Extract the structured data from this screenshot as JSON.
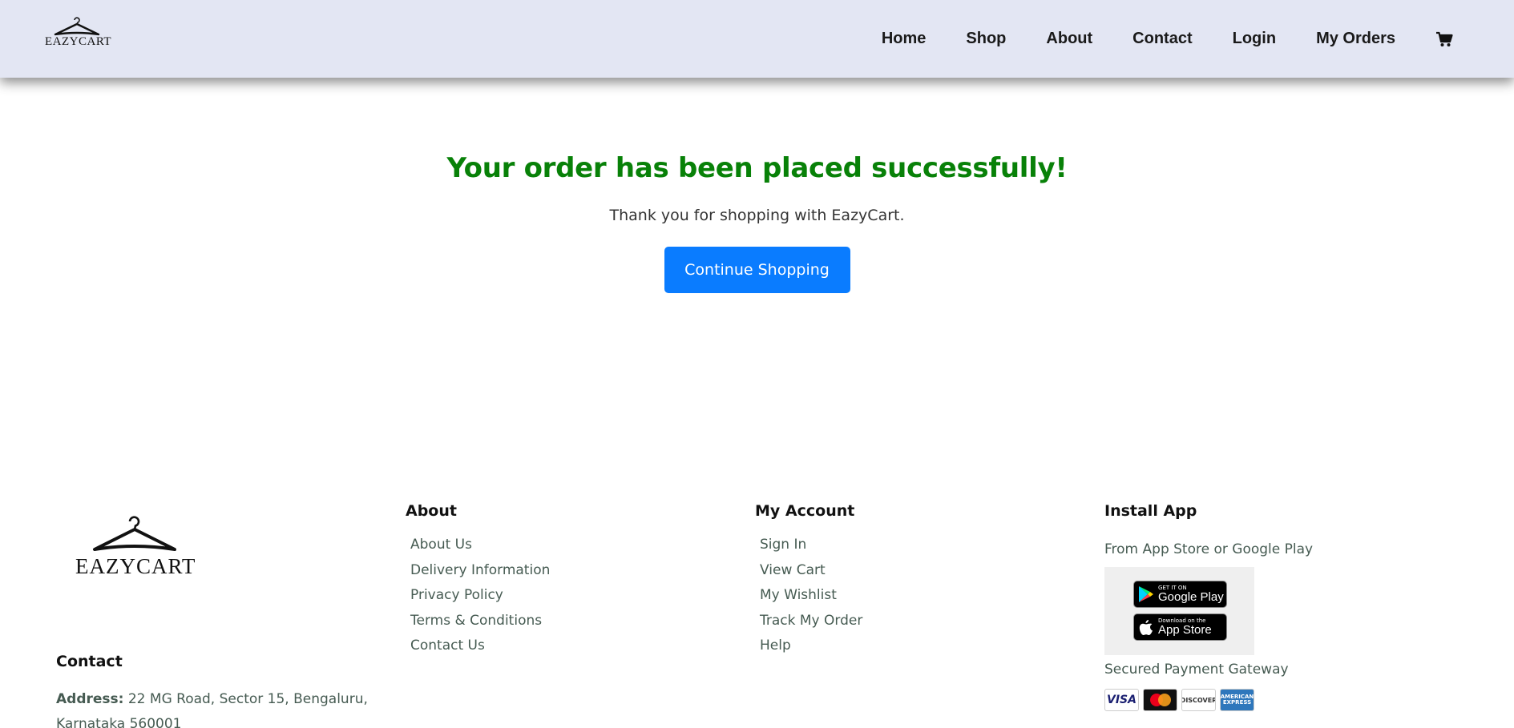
{
  "brand": {
    "name": "EAZYCART"
  },
  "nav": {
    "items": [
      "Home",
      "Shop",
      "About",
      "Contact",
      "Login",
      "My Orders"
    ],
    "cart_icon": "cart-icon"
  },
  "main": {
    "title": "Your order has been placed successfully!",
    "subtitle": "Thank you for shopping with EazyCart.",
    "button": "Continue Shopping",
    "title_color": "#088108",
    "button_color": "#0a7cff"
  },
  "footer": {
    "contact_title": "Contact",
    "address_label": "Address:",
    "address_value": "22 MG Road, Sector 15, Bengaluru, Karnataka 560001",
    "about": {
      "title": "About",
      "links": [
        "About Us",
        "Delivery Information",
        "Privacy Policy",
        "Terms & Conditions",
        "Contact Us"
      ]
    },
    "account": {
      "title": "My Account",
      "links": [
        "Sign In",
        "View Cart",
        "My Wishlist",
        "Track My Order",
        "Help"
      ]
    },
    "install": {
      "title": "Install App",
      "desc": "From App Store or Google Play",
      "google_small": "GET IT ON",
      "google_big": "Google Play",
      "apple_small": "Download on the",
      "apple_big": "App Store",
      "secured": "Secured Payment Gateway",
      "cards": [
        "VISA",
        "DISCOVER",
        "AMERICAN EXPRESS"
      ]
    }
  }
}
